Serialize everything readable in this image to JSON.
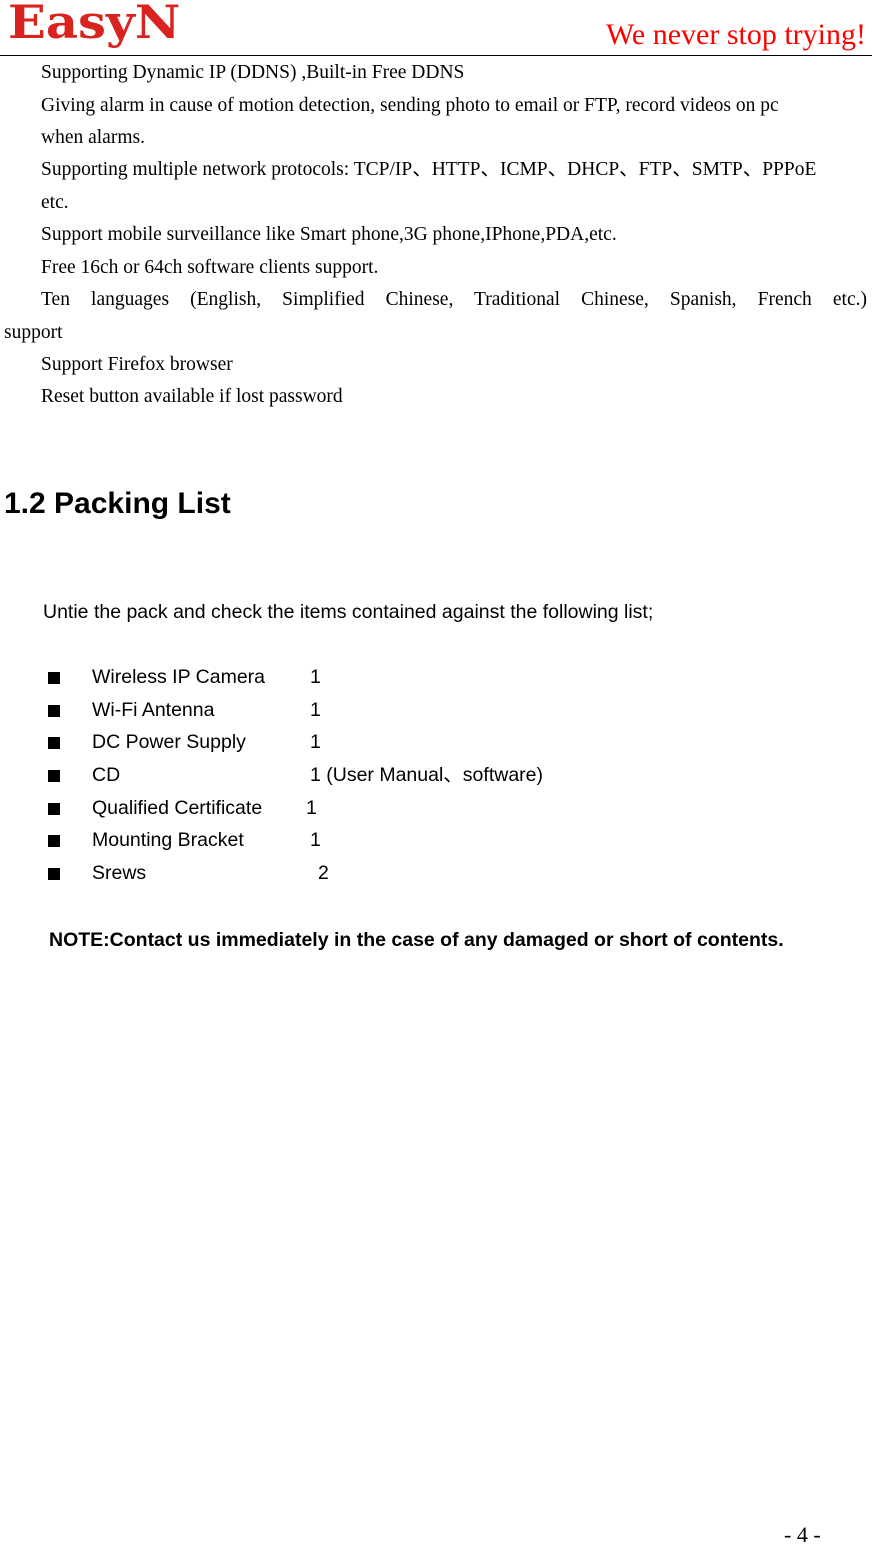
{
  "header": {
    "logo": "EasyN",
    "slogan": "We never stop trying!",
    "colors": {
      "logo": "#d8231e",
      "slogan": "#ff0000"
    }
  },
  "features": [
    {
      "text": "Supporting Dynamic IP (DDNS) ,Built-in Free DDNS"
    },
    {
      "text": "Giving alarm in cause of motion detection, sending photo to email or FTP, record videos on pc",
      "continuation": "when alarms."
    },
    {
      "text": "Supporting multiple network protocols: TCP/IP、HTTP、ICMP、DHCP、FTP、SMTP、PPPoE",
      "continuation": "etc."
    },
    {
      "text": "Support mobile surveillance like Smart phone,3G phone,IPhone,PDA,etc."
    },
    {
      "text": "Free 16ch or 64ch software clients support."
    },
    {
      "text": "Ten languages (English, Simplified Chinese, Traditional Chinese, Spanish, French etc.)",
      "continuation": "support"
    },
    {
      "text": "Support Firefox browser"
    },
    {
      "text": "Reset button available if lost password"
    }
  ],
  "section": {
    "heading": "1.2 Packing List",
    "intro": "Untie the pack and check the items contained against the following list;",
    "items": [
      {
        "name": "Wireless IP Camera",
        "qty": "1"
      },
      {
        "name": "Wi-Fi Antenna",
        "qty": "1"
      },
      {
        "name": "DC Power Supply",
        "qty": "1"
      },
      {
        "name": "CD",
        "qty": "1 (User Manual、software)"
      },
      {
        "name": "Qualified Certificate",
        "qty": "1"
      },
      {
        "name": "Mounting Bracket",
        "qty": "1"
      },
      {
        "name": "Srews",
        "qty": "2"
      }
    ],
    "note": "NOTE:Contact us immediately in the case of any damaged or short of contents."
  },
  "footer": {
    "page_number": "- 4 -"
  }
}
